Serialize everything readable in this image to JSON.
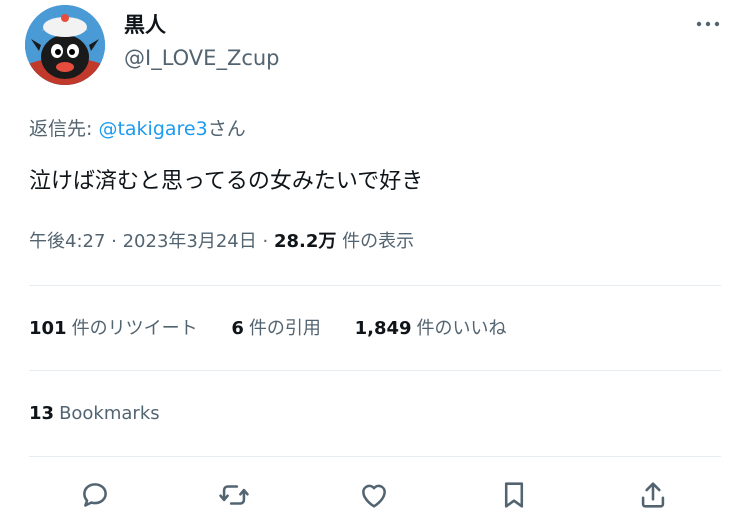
{
  "author": {
    "display_name": "黒人",
    "handle": "@I_LOVE_Zcup",
    "avatar_icon": "character-avatar"
  },
  "reply": {
    "prefix": "返信先: ",
    "target": "@takigare3",
    "suffix": "さん"
  },
  "tweet": {
    "text": "泣けば済むと思ってるの女みたいで好き"
  },
  "meta": {
    "time": "午後4:27",
    "separator": " · ",
    "date": "2023年3月24日",
    "views": "28.2万",
    "views_label": "件の表示"
  },
  "stats": {
    "retweets": "101",
    "retweets_label": "件のリツイート",
    "quotes": "6",
    "quotes_label": "件の引用",
    "likes": "1,849",
    "likes_label": "件のいいね"
  },
  "bookmarks": {
    "count": "13",
    "label": "Bookmarks"
  },
  "actions": [
    "reply-icon",
    "retweet-icon",
    "like-icon",
    "bookmark-icon",
    "share-icon"
  ],
  "colors": {
    "link": "#1d9bf0",
    "secondary_text": "#536471",
    "primary_text": "#0f1419",
    "divider": "#e6ecf0"
  }
}
